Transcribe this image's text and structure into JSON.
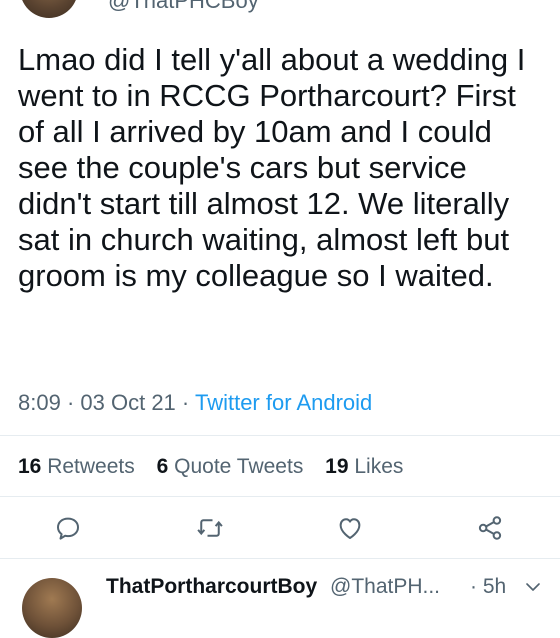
{
  "tweet": {
    "handle": "@ThatPHCBoy",
    "text": "Lmao did I tell y'all about a wedding I went to in RCCG Portharcourt? First of all I arrived by 10am and I could see the couple's cars but service didn't start till almost 12. We literally sat in church waiting, almost left but groom is my colleague so I waited.",
    "time": "8:09",
    "date": "03 Oct 21",
    "separator": "·",
    "source": "Twitter for Android"
  },
  "stats": {
    "retweets_count": "16",
    "retweets_label": "Retweets",
    "quotes_count": "6",
    "quotes_label": "Quote Tweets",
    "likes_count": "19",
    "likes_label": "Likes"
  },
  "actions": [
    {
      "icon": "reply-icon"
    },
    {
      "icon": "retweet-icon"
    },
    {
      "icon": "like-icon"
    },
    {
      "icon": "share-icon"
    }
  ],
  "reply": {
    "name": "ThatPortharcourtBoy",
    "handle": "@ThatPH...",
    "time": "· 5h"
  },
  "colors": {
    "text": "#0f1419",
    "secondary": "#536471",
    "link": "#1d9bf0",
    "divider": "#e6ecf0"
  }
}
